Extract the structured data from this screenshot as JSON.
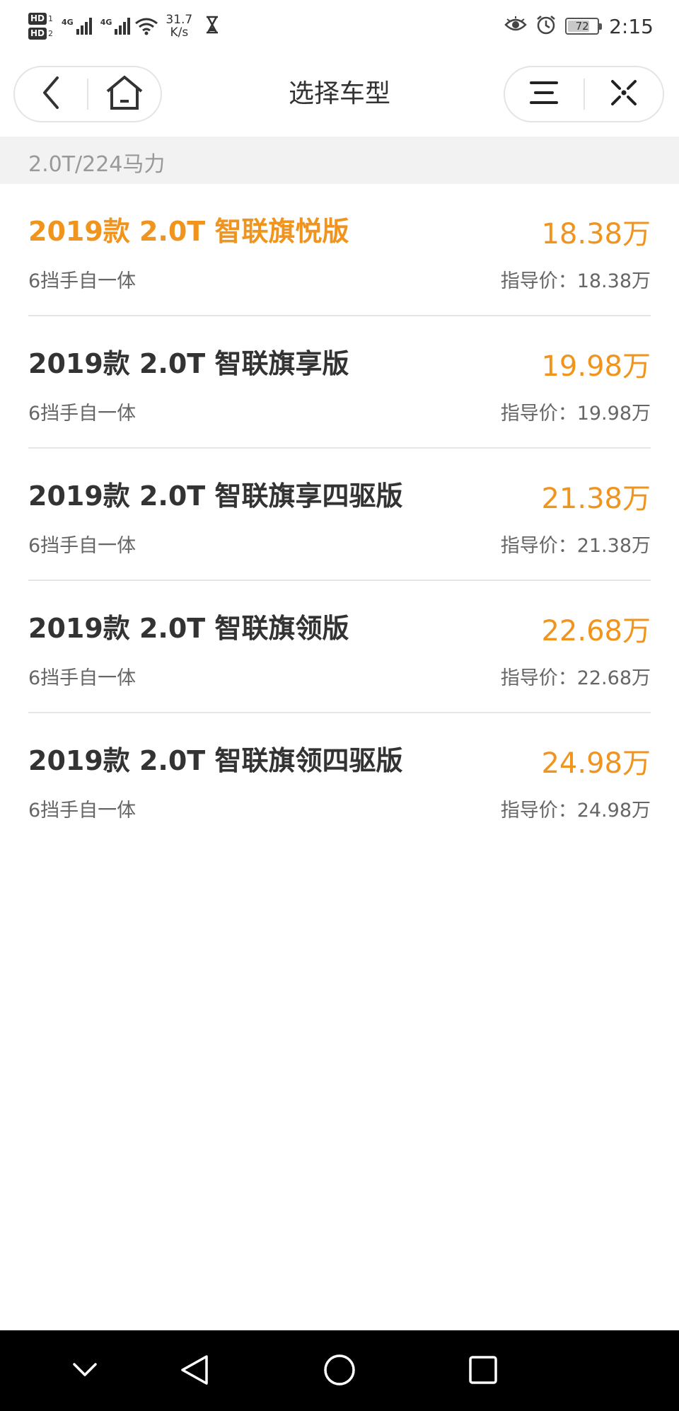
{
  "status_bar": {
    "hd1": "HD",
    "hd1_num": "1",
    "hd2": "HD",
    "hd2_num": "2",
    "signal1_label": "4G",
    "signal2_label": "4G",
    "speed_value": "31.7",
    "speed_unit": "K/s",
    "battery": "72",
    "time": "2:15"
  },
  "header": {
    "title": "选择车型"
  },
  "section": {
    "label": "2.0T/224马力"
  },
  "models": [
    {
      "name": "2019款 2.0T 智联旗悦版",
      "price": "18.38万",
      "transmission": "6挡手自一体",
      "guide_price": "指导价：18.38万",
      "selected": true
    },
    {
      "name": "2019款 2.0T 智联旗享版",
      "price": "19.98万",
      "transmission": "6挡手自一体",
      "guide_price": "指导价：19.98万",
      "selected": false
    },
    {
      "name": "2019款 2.0T 智联旗享四驱版",
      "price": "21.38万",
      "transmission": "6挡手自一体",
      "guide_price": "指导价：21.38万",
      "selected": false
    },
    {
      "name": "2019款 2.0T 智联旗领版",
      "price": "22.68万",
      "transmission": "6挡手自一体",
      "guide_price": "指导价：22.68万",
      "selected": false
    },
    {
      "name": "2019款 2.0T 智联旗领四驱版",
      "price": "24.98万",
      "transmission": "6挡手自一体",
      "guide_price": "指导价：24.98万",
      "selected": false
    }
  ],
  "colors": {
    "accent": "#f0941d",
    "section_bg": "#f2f2f2",
    "text_primary": "#333333",
    "text_secondary": "#666666"
  },
  "icons": {
    "back": "chevron-left-icon",
    "home": "home-icon",
    "menu": "hamburger-menu-icon",
    "close": "close-dots-icon",
    "sys_back": "triangle-back-icon",
    "sys_home": "circle-home-icon",
    "sys_recent": "square-recents-icon",
    "sys_collapse": "chevron-down-icon"
  }
}
